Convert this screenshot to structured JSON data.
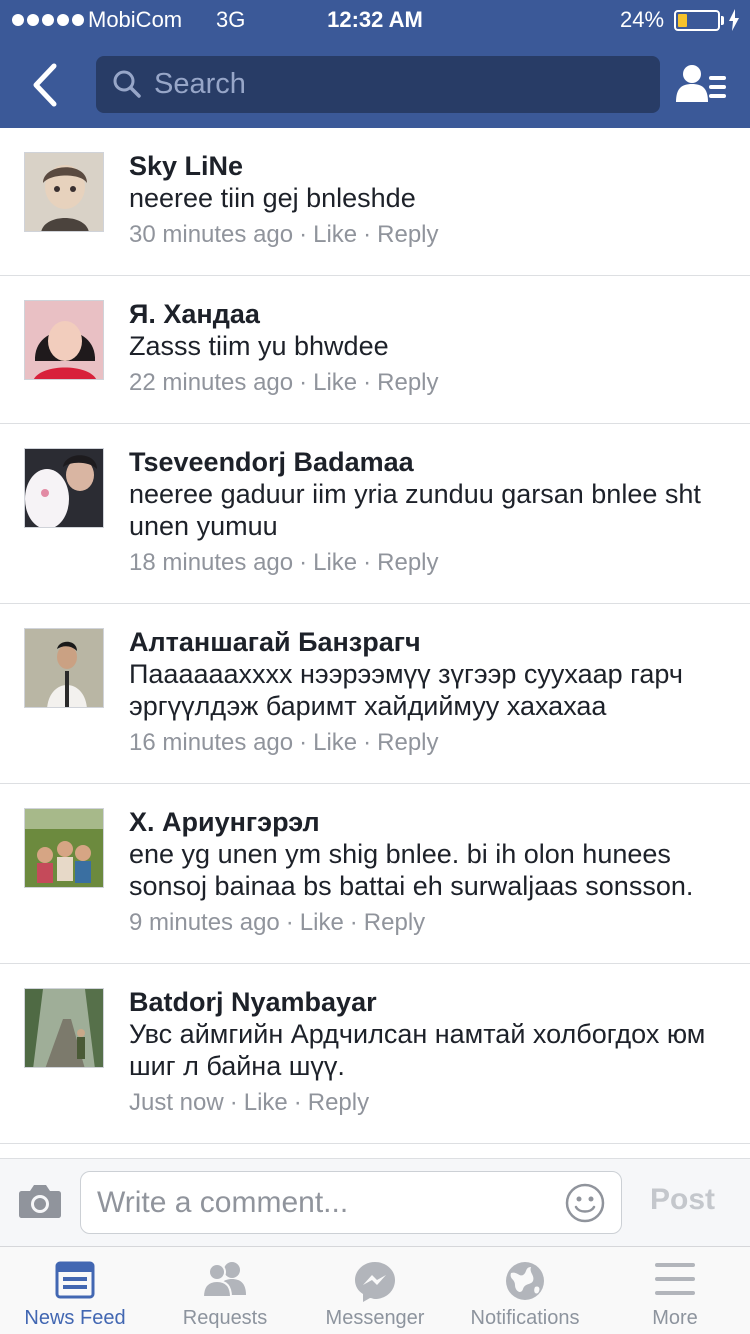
{
  "status_bar": {
    "carrier": "MobiCom",
    "network": "3G",
    "time": "12:32 AM",
    "battery_percent": "24%",
    "battery_level": 0.24,
    "battery_color": "#f7c32b"
  },
  "nav": {
    "search_placeholder": "Search",
    "back_icon": "chevron-left-icon",
    "friends_icon": "friend-list-icon",
    "background_color": "#3b5998"
  },
  "comments": [
    {
      "author": "Sky LiNe",
      "text": "neeree tiin gej bnleshde",
      "time": "30 minutes ago",
      "like": "Like",
      "reply": "Reply"
    },
    {
      "author": "Я. Хандаа",
      "text": "Zasss tiim yu bhwdee",
      "time": "22 minutes ago",
      "like": "Like",
      "reply": "Reply"
    },
    {
      "author": "Tseveendorj Badamaa",
      "text": "neeree gaduur iim yria zunduu garsan bnlee sht unen yumuu",
      "time": "18 minutes ago",
      "like": "Like",
      "reply": "Reply"
    },
    {
      "author": "Алтаншагай Банзрагч",
      "text": "Паааааaxxxx нээрээмүү зүгээр суухаар гарч эргүүлдэж баримт хайдиймуу хахахаа",
      "time": "16 minutes ago",
      "like": "Like",
      "reply": "Reply"
    },
    {
      "author": "Х. Ариунгэрэл",
      "text": "ene yg unen ym shig bnlee. bi ih olon hunees sonsoj bainaa bs battai eh surwaljaas sonsson.",
      "time": "9 minutes ago",
      "like": "Like",
      "reply": "Reply"
    },
    {
      "author": "Batdorj Nyambayar",
      "text": "Увс аймгийн Ардчилсан намтай холбогдох юм шиг л байна шүү.",
      "time": "Just now",
      "like": "Like",
      "reply": "Reply"
    }
  ],
  "composer": {
    "placeholder": "Write a comment...",
    "post_label": "Post",
    "camera_icon": "camera-icon",
    "emoji_icon": "smiley-icon"
  },
  "tabs": [
    {
      "label": "News Feed",
      "icon": "news-feed-icon",
      "active": true
    },
    {
      "label": "Requests",
      "icon": "friend-requests-icon",
      "active": false
    },
    {
      "label": "Messenger",
      "icon": "messenger-icon",
      "active": false
    },
    {
      "label": "Notifications",
      "icon": "globe-icon",
      "active": false
    },
    {
      "label": "More",
      "icon": "menu-icon",
      "active": false
    }
  ],
  "colors": {
    "brand": "#3b5998",
    "active_tab": "#4267b2",
    "meta_text": "#90949c"
  }
}
